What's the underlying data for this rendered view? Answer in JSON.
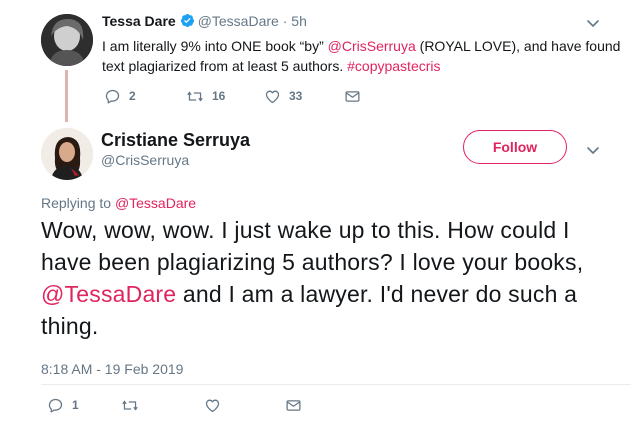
{
  "parent_tweet": {
    "name": "Tessa Dare",
    "handle": "@TessaDare",
    "separator": "·",
    "time": "5h",
    "text_before": "I am literally 9% into ONE book “by” ",
    "mention": "@CrisSerruya",
    "text_middle": " (ROYAL LOVE), and have found text plagiarized from at least 5 authors. ",
    "hashtag": "#copypastecris",
    "actions": {
      "reply_count": "2",
      "retweet_count": "16",
      "like_count": "33"
    },
    "icons": [
      "verified-icon",
      "chevron-down-icon",
      "reply-icon",
      "retweet-icon",
      "like-icon",
      "direct-message-icon"
    ]
  },
  "main_tweet": {
    "name": "Cristiane Serruya",
    "handle": "@CrisSerruya",
    "follow_label": "Follow",
    "replying_prefix": "Replying to ",
    "replying_to": "@TessaDare",
    "text_part1": "Wow, wow, wow. I just wake up to this. How could I have been plagiarizing 5 authors? I love your books, ",
    "text_mention": "@TessaDare",
    "text_part2": " and I am a lawyer. I'd never do such a thing.",
    "timestamp": "8:18 AM - 19 Feb 2019",
    "actions": {
      "reply_count": "1"
    },
    "icons": [
      "chevron-down-icon",
      "reply-icon",
      "retweet-icon",
      "like-icon",
      "direct-message-icon"
    ]
  },
  "colors": {
    "accent": "#e0245e",
    "secondary_text": "#657786",
    "primary_text": "#14171a",
    "verified_blue": "#1da1f2",
    "thread_line": "#dbb6b0"
  }
}
